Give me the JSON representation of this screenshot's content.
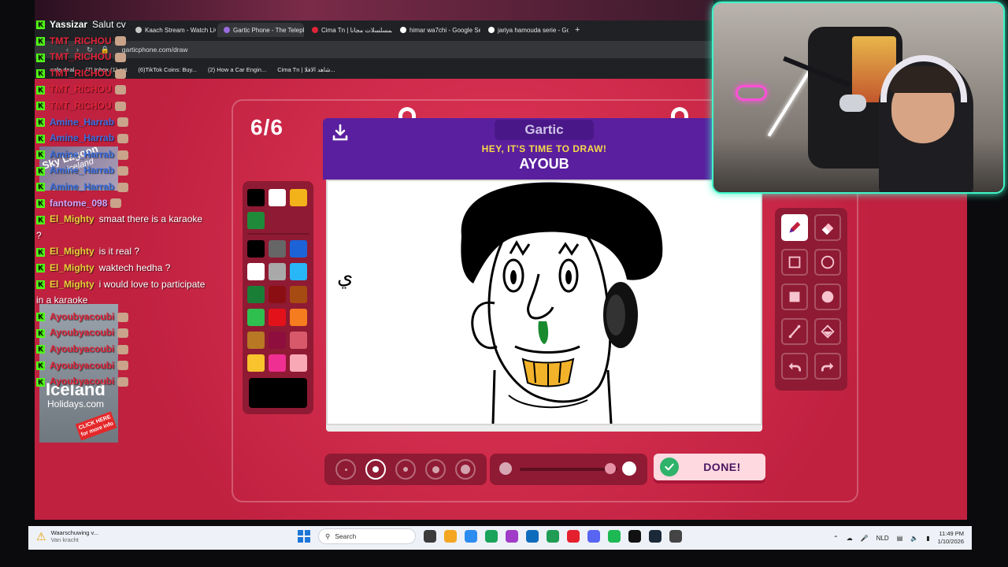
{
  "browser": {
    "tabs": [
      {
        "label": "Kaach Stream - Watch Liv"
      },
      {
        "label": "Gartic Phone - The Teleph",
        "active": true
      },
      {
        "label": "Cima Tn | المسلسلات مجانا"
      },
      {
        "label": "himar wa7chi - Google Se"
      },
      {
        "label": "jariya hamouda serie - Go"
      }
    ],
    "new_tab": "+",
    "url": "garticphone.com/draw",
    "bookmarks": [
      "safe deal",
      "(7) Inbox (1) ect",
      "(6)TikTok Coins: Buy...",
      "(2) How a Car Engin...",
      "Cima Tn | شاهد الافلا..."
    ]
  },
  "game": {
    "round": "6/6",
    "logo": "Gartic",
    "prompt_heading": "HEY, IT'S TIME TO DRAW!",
    "prompt_word": "AYOUB",
    "done_label": "DONE!",
    "selected_tool": "pen",
    "selected_size_index": 1,
    "opacity_level": 0.9,
    "palette_top": [
      "#000000",
      "#ffffff",
      "#f3b21a",
      "#1f8b3a"
    ],
    "palette_main": [
      "#000000",
      "#666666",
      "#1b63d6",
      "#ffffff",
      "#a9a9a9",
      "#29b6f6",
      "#1a7f36",
      "#8b0f12",
      "#a64b12",
      "#2fbf4f",
      "#e3121a",
      "#f57c1f",
      "#b87824",
      "#8e0f3e",
      "#d85a6a",
      "#f8c32c",
      "#ef2f92",
      "#f8a8b4"
    ],
    "current_color": "#000000",
    "drawing_letter": "ي"
  },
  "chat": [
    {
      "name": "Yassizar",
      "msg": "Salut cv",
      "color": "#ffffff"
    },
    {
      "name": "TMT_RICHOU",
      "msg": "",
      "color": "#e0243a"
    },
    {
      "name": "TMT_RICHOU",
      "msg": "",
      "color": "#e0243a"
    },
    {
      "name": "TMT_RICHOU",
      "msg": "",
      "color": "#e0243a"
    },
    {
      "name": "TMT_RICHOU",
      "msg": "",
      "color": "#e0243a"
    },
    {
      "name": "TMT_RICHOU",
      "msg": "",
      "color": "#e0243a"
    },
    {
      "name": "Amine_Harrab",
      "msg": "",
      "color": "#3a6fe0"
    },
    {
      "name": "Amine_Harrab",
      "msg": "",
      "color": "#3a6fe0"
    },
    {
      "name": "Amine_Harrab",
      "msg": "",
      "color": "#3a6fe0"
    },
    {
      "name": "Amine_Harrab",
      "msg": "",
      "color": "#3a6fe0"
    },
    {
      "name": "Amine_Harrab",
      "msg": "",
      "color": "#3a6fe0"
    },
    {
      "name": "fantome_098",
      "msg": "",
      "color": "#c9a7ff"
    },
    {
      "name": "El_Mighty",
      "msg": "smaat there is a karaoke",
      "color": "#e7d23a"
    },
    {
      "name": "",
      "msg": "?",
      "color": "#ffffff"
    },
    {
      "name": "El_Mighty",
      "msg": "is it real ?",
      "color": "#e7d23a"
    },
    {
      "name": "El_Mighty",
      "msg": "waktech hedha ?",
      "color": "#e7d23a"
    },
    {
      "name": "El_Mighty",
      "msg": "i would love to participate",
      "color": "#e7d23a"
    },
    {
      "name": "",
      "msg": "in a karaoke",
      "color": "#ffffff"
    },
    {
      "name": "Ayoubyacoubi",
      "msg": "",
      "color": "#e0243a"
    },
    {
      "name": "Ayoubyacoubi",
      "msg": "",
      "color": "#e0243a"
    },
    {
      "name": "Ayoubyacoubi",
      "msg": "",
      "color": "#e0243a"
    },
    {
      "name": "Ayoubyacoubi",
      "msg": "",
      "color": "#e0243a"
    },
    {
      "name": "Ayoubyacoubi",
      "msg": "",
      "color": "#e0243a"
    }
  ],
  "ad": {
    "title": "Sky Lagoon",
    "subtitle": "Iceland",
    "brand": "Iceland",
    "brand_sub": "Holidays.com",
    "cta": "CLICK HERE for more info"
  },
  "taskbar": {
    "warning_title": "Waarschuwing v...",
    "warning_sub": "Van kracht",
    "search_placeholder": "Search",
    "language": "NLD",
    "time": "11:49 PM",
    "date": "1/10/2026",
    "app_colors": [
      "#3b3b3b",
      "#f4a623",
      "#2d8cf0",
      "#1aa35b",
      "#a03cc7",
      "#0f6cbd",
      "#1f9d55",
      "#e5202e",
      "#5865f2",
      "#1db954",
      "#111111",
      "#1b2838",
      "#444444"
    ]
  }
}
